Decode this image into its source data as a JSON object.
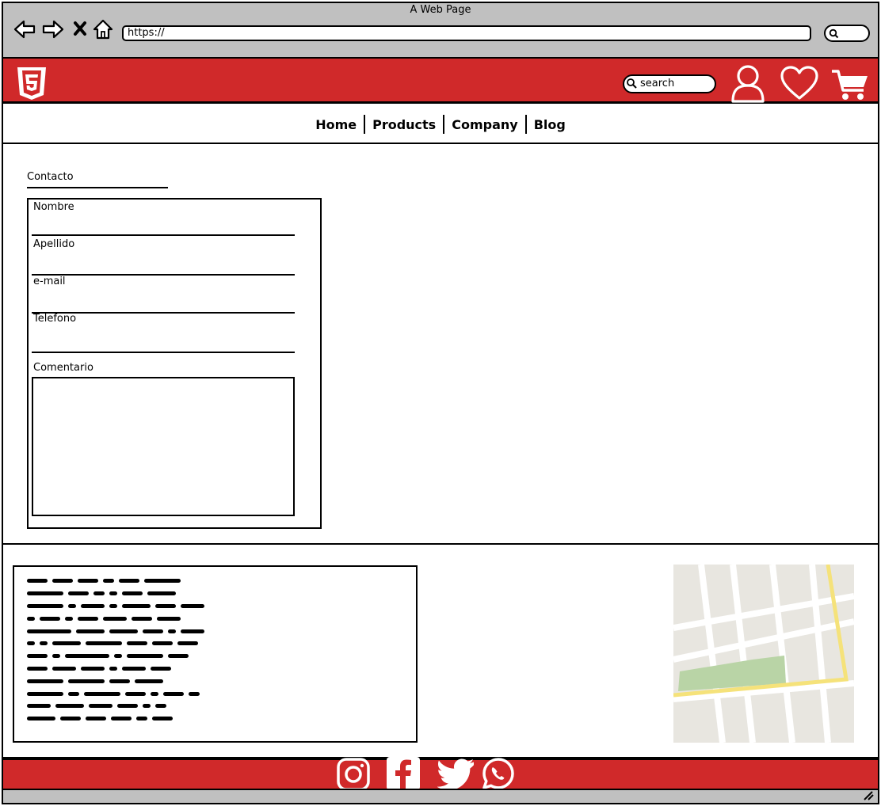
{
  "window": {
    "title": "A Web Page",
    "url": "https://"
  },
  "header": {
    "search_placeholder": "search"
  },
  "menu": {
    "items": [
      "Home",
      "Products",
      "Company",
      "Blog"
    ]
  },
  "contact": {
    "title": "Contacto",
    "fields": {
      "nombre": "Nombre",
      "apellido": "Apellido",
      "email": "e-mail",
      "telefono": "Telefono",
      "comentario": "Comentario"
    }
  },
  "colors": {
    "header_red": "#d0292a",
    "frame_gray": "#c0c0c0"
  },
  "icons": [
    "back-icon",
    "forward-icon",
    "close-icon",
    "home-icon",
    "search-icon",
    "html5-logo",
    "user-icon",
    "heart-icon",
    "cart-icon",
    "instagram-icon",
    "facebook-icon",
    "twitter-icon",
    "whatsapp-icon",
    "resize-icon"
  ]
}
